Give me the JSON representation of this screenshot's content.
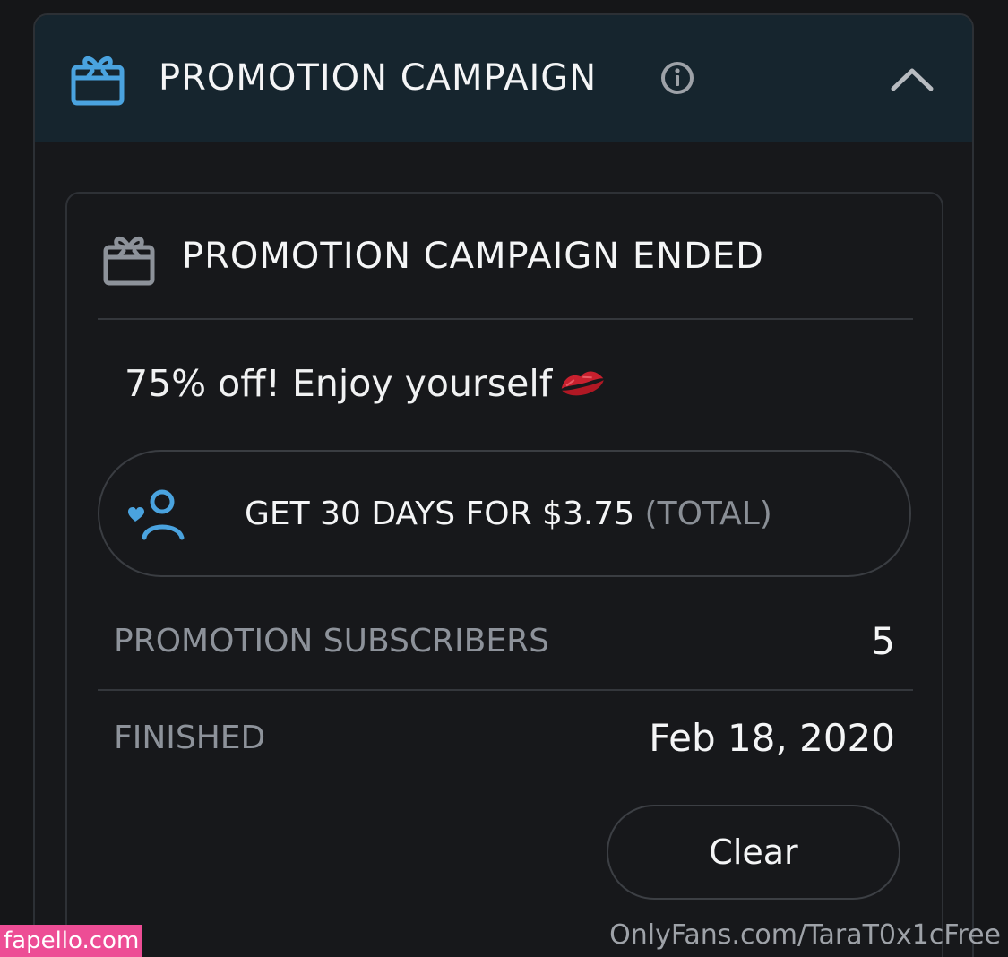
{
  "header": {
    "title": "PROMOTION CAMPAIGN",
    "icon": "gift-icon",
    "info_icon": "info-icon",
    "collapse_icon": "chevron-up-icon"
  },
  "campaign": {
    "title": "PROMOTION CAMPAIGN ENDED",
    "icon": "gift-icon",
    "message": "75% off! Enjoy yourself",
    "message_icon": "kiss-mark-icon",
    "offer": {
      "icon": "user-heart-icon",
      "label": "GET 30 DAYS FOR $3.75",
      "suffix": "(TOTAL)"
    },
    "stats": [
      {
        "label": "PROMOTION SUBSCRIBERS",
        "value": "5"
      },
      {
        "label": "FINISHED",
        "value": "Feb 18, 2020"
      }
    ],
    "clear_label": "Clear"
  },
  "watermarks": {
    "left": "fapello.com",
    "right": "OnlyFans.com/TaraT0x1cFree"
  },
  "colors": {
    "accent": "#4aa3df",
    "background": "#151618",
    "header_background": "#16252e",
    "kiss": "#c8202e",
    "watermark_pink": "#ed4d95"
  }
}
